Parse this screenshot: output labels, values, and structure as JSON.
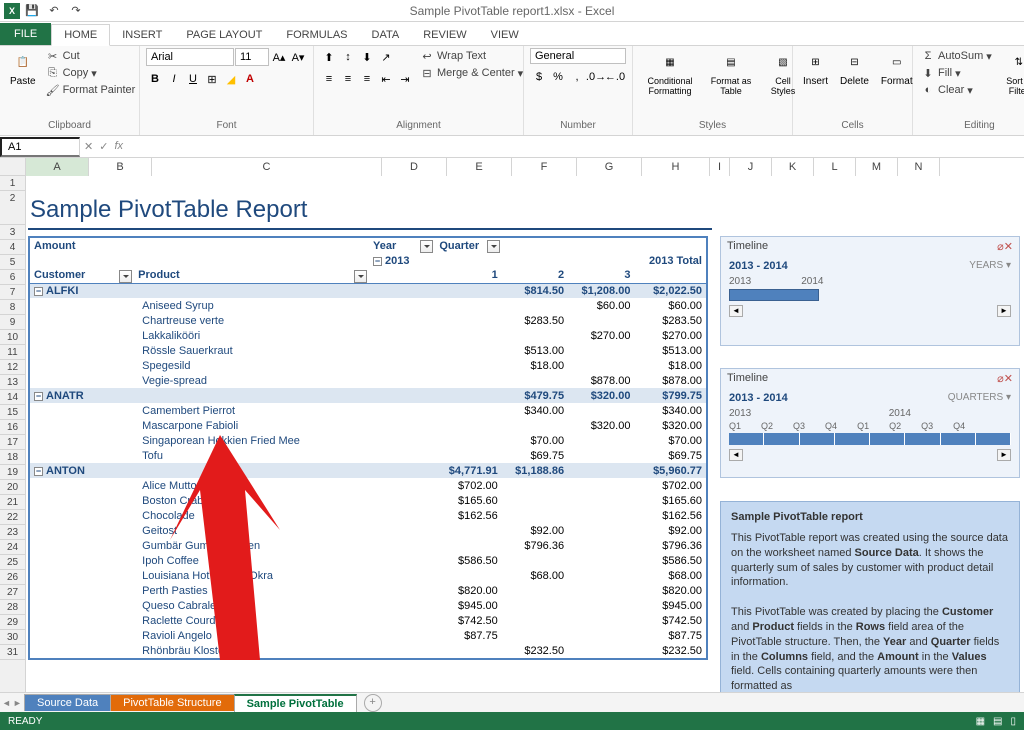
{
  "app": {
    "title": "Sample PivotTable report1.xlsx - Excel"
  },
  "tabs": {
    "file": "FILE",
    "home": "HOME",
    "insert": "INSERT",
    "pagelayout": "PAGE LAYOUT",
    "formulas": "FORMULAS",
    "data": "DATA",
    "review": "REVIEW",
    "view": "VIEW"
  },
  "ribbon": {
    "clipboard": {
      "label": "Clipboard",
      "paste": "Paste",
      "cut": "Cut",
      "copy": "Copy",
      "painter": "Format Painter"
    },
    "font": {
      "label": "Font",
      "family": "Arial",
      "size": "11"
    },
    "alignment": {
      "label": "Alignment",
      "wrap": "Wrap Text",
      "merge": "Merge & Center"
    },
    "number": {
      "label": "Number",
      "format": "General"
    },
    "styles": {
      "label": "Styles",
      "cond": "Conditional Formatting",
      "fat": "Format as Table",
      "cell": "Cell Styles"
    },
    "cells": {
      "label": "Cells",
      "insert": "Insert",
      "delete": "Delete",
      "format": "Format"
    },
    "editing": {
      "label": "Editing",
      "autosum": "AutoSum",
      "fill": "Fill",
      "clear": "Clear",
      "sortfilt": "Sort & Filter"
    }
  },
  "namebox": "A1",
  "cols": [
    "A",
    "B",
    "C",
    "D",
    "E",
    "F",
    "G",
    "H",
    "I",
    "J",
    "K",
    "L",
    "M",
    "N"
  ],
  "sheet_title": "Sample PivotTable Report",
  "pivot": {
    "amount": "Amount",
    "year": "Year",
    "quarter": "Quarter",
    "y2013": "2013",
    "total": "2013 Total",
    "customer": "Customer",
    "product": "Product",
    "q1": "1",
    "q2": "2",
    "q3": "3"
  },
  "rows": [
    {
      "type": "group",
      "label": "ALFKI",
      "c1": "",
      "c2": "$814.50",
      "c3": "$1,208.00",
      "tot": "$2,022.50"
    },
    {
      "type": "prod",
      "label": "Aniseed Syrup",
      "c1": "",
      "c2": "",
      "c3": "$60.00",
      "tot": "$60.00"
    },
    {
      "type": "prod",
      "label": "Chartreuse verte",
      "c1": "",
      "c2": "$283.50",
      "c3": "",
      "tot": "$283.50"
    },
    {
      "type": "prod",
      "label": "Lakkalikööri",
      "c1": "",
      "c2": "",
      "c3": "$270.00",
      "tot": "$270.00"
    },
    {
      "type": "prod",
      "label": "Rössle Sauerkraut",
      "c1": "",
      "c2": "$513.00",
      "c3": "",
      "tot": "$513.00"
    },
    {
      "type": "prod",
      "label": "Spegesild",
      "c1": "",
      "c2": "$18.00",
      "c3": "",
      "tot": "$18.00"
    },
    {
      "type": "prod",
      "label": "Vegie-spread",
      "c1": "",
      "c2": "",
      "c3": "$878.00",
      "tot": "$878.00"
    },
    {
      "type": "group",
      "label": "ANATR",
      "c1": "",
      "c2": "$479.75",
      "c3": "$320.00",
      "tot": "$799.75"
    },
    {
      "type": "prod",
      "label": "Camembert Pierrot",
      "c1": "",
      "c2": "$340.00",
      "c3": "",
      "tot": "$340.00"
    },
    {
      "type": "prod",
      "label": "Mascarpone Fabioli",
      "c1": "",
      "c2": "",
      "c3": "$320.00",
      "tot": "$320.00"
    },
    {
      "type": "prod",
      "label": "Singaporean Hokkien Fried Mee",
      "c1": "",
      "c2": "$70.00",
      "c3": "",
      "tot": "$70.00"
    },
    {
      "type": "prod",
      "label": "Tofu",
      "c1": "",
      "c2": "$69.75",
      "c3": "",
      "tot": "$69.75"
    },
    {
      "type": "group",
      "label": "ANTON",
      "c1": "$4,771.91",
      "c2": "$1,188.86",
      "c3": "",
      "tot": "$5,960.77"
    },
    {
      "type": "prod",
      "label": "Alice Mutton",
      "c1": "$702.00",
      "c2": "",
      "c3": "",
      "tot": "$702.00"
    },
    {
      "type": "prod",
      "label": "Boston Crab Meat",
      "c1": "$165.60",
      "c2": "",
      "c3": "",
      "tot": "$165.60"
    },
    {
      "type": "prod",
      "label": "Chocolade",
      "c1": "$162.56",
      "c2": "",
      "c3": "",
      "tot": "$162.56"
    },
    {
      "type": "prod",
      "label": "Geitost",
      "c1": "",
      "c2": "$92.00",
      "c3": "",
      "tot": "$92.00"
    },
    {
      "type": "prod",
      "label": "Gumbär Gummibärchen",
      "c1": "",
      "c2": "$796.36",
      "c3": "",
      "tot": "$796.36"
    },
    {
      "type": "prod",
      "label": "Ipoh Coffee",
      "c1": "$586.50",
      "c2": "",
      "c3": "",
      "tot": "$586.50"
    },
    {
      "type": "prod",
      "label": "Louisiana Hot Spiced Okra",
      "c1": "",
      "c2": "$68.00",
      "c3": "",
      "tot": "$68.00"
    },
    {
      "type": "prod",
      "label": "Perth Pasties",
      "c1": "$820.00",
      "c2": "",
      "c3": "",
      "tot": "$820.00"
    },
    {
      "type": "prod",
      "label": "Queso Cabrales",
      "c1": "$945.00",
      "c2": "",
      "c3": "",
      "tot": "$945.00"
    },
    {
      "type": "prod",
      "label": "Raclette Courdavault",
      "c1": "$742.50",
      "c2": "",
      "c3": "",
      "tot": "$742.50"
    },
    {
      "type": "prod",
      "label": "Ravioli Angelo",
      "c1": "$87.75",
      "c2": "",
      "c3": "",
      "tot": "$87.75"
    },
    {
      "type": "prod",
      "label": "Rhönbräu Klosterbier",
      "c1": "",
      "c2": "$232.50",
      "c3": "",
      "tot": "$232.50"
    }
  ],
  "timeline1": {
    "title": "Timeline",
    "range": "2013 - 2014",
    "unit": "YEARS",
    "y1": "2013",
    "y2": "2014"
  },
  "timeline2": {
    "title": "Timeline",
    "range": "2013 - 2014",
    "unit": "QUARTERS",
    "y1": "2013",
    "y2": "2014",
    "q": [
      "Q1",
      "Q2",
      "Q3",
      "Q4",
      "Q1",
      "Q2",
      "Q3",
      "Q4"
    ]
  },
  "info": {
    "title": "Sample PivotTable report",
    "p1a": "This PivotTable report was created using the source data on the worksheet named ",
    "p1b": "Source Data",
    "p1c": ". It shows the quarterly sum of sales by customer with product detail information.",
    "p2a": "This PivotTable was created by placing the ",
    "p2b": "Customer",
    "p2c": " and ",
    "p2d": "Product",
    "p2e": " fields in the ",
    "p2f": "Rows",
    "p2g": " field area of the PivotTable structure. Then, the ",
    "p2h": "Year",
    "p2i": " and ",
    "p2j": "Quarter",
    "p2k": " fields in the ",
    "p2l": "Columns",
    "p2m": " field, and the ",
    "p2n": "Amount",
    "p2o": " in the ",
    "p2p": "Values",
    "p2q": " field.  Cells containing quarterly amounts were then formatted as"
  },
  "sheettabs": {
    "t1": "Source Data",
    "t2": "PivotTable Structure",
    "t3": "Sample PivotTable"
  },
  "status": "READY"
}
